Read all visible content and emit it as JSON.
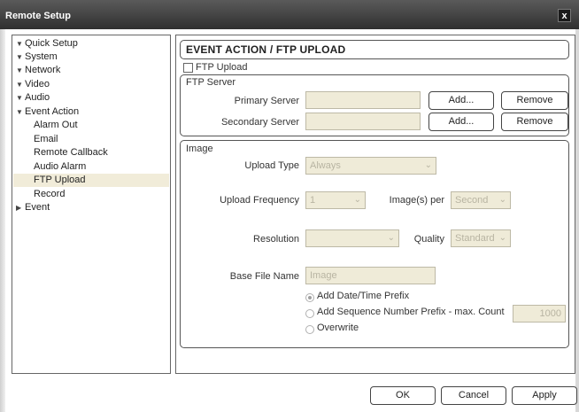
{
  "window": {
    "title": "Remote Setup",
    "close_glyph": "x"
  },
  "tree": {
    "items": [
      {
        "label": "Quick Setup",
        "expander": "▼"
      },
      {
        "label": "System",
        "expander": "▼"
      },
      {
        "label": "Network",
        "expander": "▼"
      },
      {
        "label": "Video",
        "expander": "▼"
      },
      {
        "label": "Audio",
        "expander": "▼"
      },
      {
        "label": "Event Action",
        "expander": "▼"
      },
      {
        "label": "Alarm Out",
        "expander": ""
      },
      {
        "label": "Email",
        "expander": ""
      },
      {
        "label": "Remote Callback",
        "expander": ""
      },
      {
        "label": "Audio Alarm",
        "expander": ""
      },
      {
        "label": "FTP Upload",
        "expander": "",
        "selected": true
      },
      {
        "label": "Record",
        "expander": ""
      },
      {
        "label": "Event",
        "expander": "▶"
      }
    ]
  },
  "panel": {
    "title": "EVENT ACTION / FTP UPLOAD",
    "ftp_upload_label": "FTP Upload",
    "ftp_upload_checked": false
  },
  "ftp_server": {
    "title": "FTP Server",
    "primary_label": "Primary Server",
    "primary_value": "",
    "secondary_label": "Secondary Server",
    "secondary_value": "",
    "add_label": "Add...",
    "remove_label": "Remove"
  },
  "image": {
    "title": "Image",
    "upload_type_label": "Upload Type",
    "upload_type_value": "Always",
    "upload_frequency_label": "Upload Frequency",
    "upload_frequency_value": "1",
    "images_per_label": "Image(s) per",
    "images_per_value": "Second",
    "resolution_label": "Resolution",
    "resolution_value": "",
    "quality_label": "Quality",
    "quality_value": "Standard",
    "base_file_name_label": "Base File Name",
    "base_file_name_value": "Image",
    "option_datetime": "Add Date/Time Prefix",
    "option_sequence": "Add Sequence Number Prefix - max. Count",
    "option_overwrite": "Overwrite",
    "max_count_value": "1000",
    "selected_option": "datetime"
  },
  "footer": {
    "ok_label": "OK",
    "cancel_label": "Cancel",
    "apply_label": "Apply"
  },
  "colors": {
    "titlebar": "#303030",
    "disabled_field": "#efebd8",
    "tree_selected": "#f1ecd9"
  }
}
